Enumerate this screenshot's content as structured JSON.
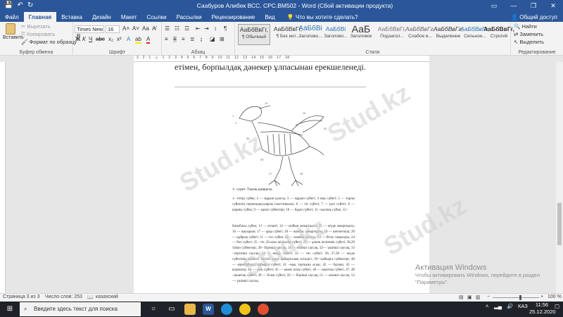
{
  "titlebar": {
    "title": "Саабуров Алибек ВСС. СРС.BM502 - Word (Сбой активации продукта)",
    "save_icon": "💾",
    "undo_icon": "↶",
    "redo_icon": "↻",
    "minimize": "—",
    "maximize": "❐",
    "close": "✕"
  },
  "tabs": [
    "Файл",
    "Главная",
    "Вставка",
    "Дизайн",
    "Макет",
    "Ссылки",
    "Рассылки",
    "Рецензирование",
    "Вид"
  ],
  "tellme": "Что вы хотите сделать?",
  "share": "Общий доступ",
  "ribbon": {
    "paste_label": "Вставить",
    "cut_label": "Вырезать",
    "copy_label": "Копировать",
    "format_painter_label": "Формат по образцу",
    "clipboard_group": "Буфер обмена",
    "font_name": "Times New R",
    "font_size": "16",
    "font_group": "Шрифт",
    "paragraph_group": "Абзац",
    "styles_group": "Стили",
    "editing_group": "Редактирование",
    "find_label": "Найти",
    "replace_label": "Заменить",
    "select_label": "Выделить",
    "styles": [
      {
        "sample": "АаБбВвГг,",
        "name": "¶ Обычный"
      },
      {
        "sample": "АаБбВвГг,",
        "name": "¶ Без инт..."
      },
      {
        "sample": "АаБбВі",
        "name": "Заголово..."
      },
      {
        "sample": "АаБбВі",
        "name": "Заголово..."
      },
      {
        "sample": "АаБ",
        "name": "Заголовок"
      },
      {
        "sample": "АаБбВвГг,",
        "name": "Подзагол..."
      },
      {
        "sample": "АаБбВвГг,",
        "name": "Слабое в..."
      },
      {
        "sample": "АаБбВвГг,",
        "name": "Выделение"
      },
      {
        "sample": "АаБбВвГг,",
        "name": "Сильное..."
      },
      {
        "sample": "АаБбВвГг,",
        "name": "Строгий"
      }
    ]
  },
  "ruler_text": "· 3 · 2 · 1 · ⊥ · 1 · 2 · 3 · 4 · 5 · 6 · 7 · 8 · 9 · 10 · 11 · 12 · 13 · 14 · 15 · 16 · 17 · 18 ·",
  "document": {
    "heading_fragment": "етімен, борпылдақ дәнекер ұлпасынан ерекшеленеді.",
    "caption": "1- сурет. Тауық қаңқасы.",
    "para1": "1– өтпір сүйек; 2 — мұрын қуысы; 3 — мұрын сүйегі; 4 жақ сүйегі; 5 — торлы сүйектің перпендикулярлы пластинкасы; 6 — тіс сүйегі; 7 — ірге сүйегі; 8 — шарны сүйек; 9 — қанат сүйектері; 10 — бұын сүйегі; 11 –жалпақ сүйек; 12 -",
    "para2": "бағыбасы сүйек; 13 — атлант; 14 — мойын омыртқасы; 15 — кеуде омыртқасы; 16 — жауырын; 17 — арқа сүйегі; 18 — жамбас омыртқасы; 19 — шегметкіш; 20 — құйрық сүйегі; 21 — тос сүйек; 22 — жамбас қуысы; 23 — бітеу саңылауы; 24 — бел сүйегі; 25 - тіз; 26 кеуе жіліншік сүйегі; 27 — ұлкен жіліншік сүйегі; 28,29 табан сүйектері; 30– бірінші саусақ; 31 — екінші саусақ; 32— үшінші саусақ; 33 –төртінші саусақ; 34 — кеуде сүйегі; 35 — төс сүйегі; 36, 37,38 — кеуде сүйегінің өрімесі; негізгі және қабырғалық өсіндісі; 39—қабырға сүйектері; 40 — коробайлық қабырға сүйегі; 41 –иық тартқыш асық; 42 — бұғана; 43 — коракоид; 44 — иық сүйегі; 45 — қанат асық сүйегі; 46 — шынтақ сүйегі; 47, 48 –шынтақ сүйегі; 49 — білек сүйегі; 50 — бірінші саусақ; 51 — екінші саусақ; 52 — үшінші саусақ."
  },
  "watermark": "Stud.kz",
  "activation": {
    "title": "Активация Windows",
    "line1": "Чтобы активировать Windows, перейдите в раздел",
    "line2": "\"Параметры\"."
  },
  "statusbar": {
    "page": "Страница 3 из 3",
    "words": "Число слов: 253",
    "language": "казахский",
    "zoom": "100 %"
  },
  "taskbar": {
    "search_placeholder": "Введите здесь текст для поиска",
    "lang": "КАЗ",
    "time": "11:56",
    "date": "25.12.2020"
  }
}
